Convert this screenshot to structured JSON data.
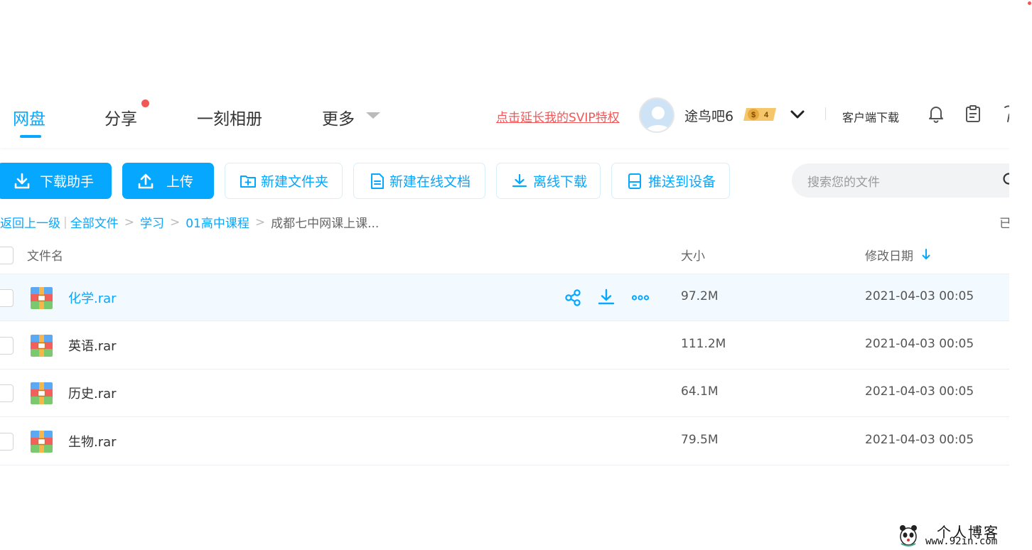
{
  "nav": {
    "tabs": [
      {
        "label": "网盘",
        "active": true
      },
      {
        "label": "分享",
        "has_dot": true
      },
      {
        "label": "一刻相册"
      },
      {
        "label": "更多"
      }
    ],
    "svip_link": "点击延长我的SVIP特权",
    "username": "途鸟吧6",
    "vip_level": "4",
    "vip_symbol": "$",
    "client_download": "客户端下载"
  },
  "toolbar": {
    "download_helper": "下载助手",
    "upload": "上传",
    "new_folder": "新建文件夹",
    "new_online_doc": "新建在线文档",
    "offline_download": "离线下载",
    "push_to_device": "推送到设备"
  },
  "search": {
    "placeholder": "搜索您的文件"
  },
  "breadcrumb": {
    "back": "返回上一级",
    "separator_bar": "|",
    "separator": ">",
    "items": [
      "全部文件",
      "学习",
      "01高中课程"
    ],
    "current": "成都七中网课上课..."
  },
  "loaded_status": "已",
  "table": {
    "headers": {
      "name": "文件名",
      "size": "大小",
      "modified": "修改日期"
    },
    "rows": [
      {
        "name": "化学.rar",
        "size": "97.2M",
        "modified": "2021-04-03 00:05",
        "hovered": true
      },
      {
        "name": "英语.rar",
        "size": "111.2M",
        "modified": "2021-04-03 00:05"
      },
      {
        "name": "历史.rar",
        "size": "64.1M",
        "modified": "2021-04-03 00:05"
      },
      {
        "name": "生物.rar",
        "size": "79.5M",
        "modified": "2021-04-03 00:05"
      }
    ]
  },
  "watermark": {
    "title": "个人博客",
    "url": "www.92in.com"
  },
  "colors": {
    "accent": "#06a7ff",
    "alert": "#f25757",
    "hover_row": "#f2faff"
  }
}
